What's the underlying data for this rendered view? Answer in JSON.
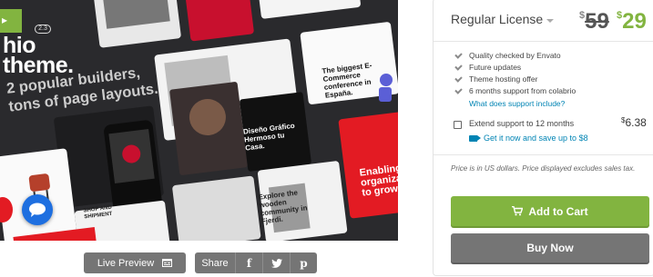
{
  "preview": {
    "hero_line1": "hio",
    "hero_line2": "theme.",
    "version_badge": "2.3",
    "subtitle_line1": "2 popular builders,",
    "subtitle_line2": "tons of page layouts.",
    "tile_texts": {
      "conference": "The biggest E-Commerce conference in España.",
      "diseno": "Diseño Gráfico Hermoso tu Casa.",
      "explore": "Explore the wooden community in Fjerdi.",
      "enabling": "Enabling organizations to grow",
      "shop": "SHOP AND SHIPMENT"
    }
  },
  "bottom_bar": {
    "live_preview_label": "Live Preview",
    "share_label": "Share",
    "share_icons": [
      "facebook-icon",
      "twitter-icon",
      "pinterest-icon"
    ],
    "facebook_glyph": "f",
    "pinterest_glyph": "p"
  },
  "purchase": {
    "license_label": "Regular License",
    "currency": "$",
    "old_price": "59",
    "new_price": "29",
    "features": [
      "Quality checked by Envato",
      "Future updates",
      "Theme hosting offer",
      "6 months support from colabrio"
    ],
    "support_link": "What does support include?",
    "extend_label": "Extend support to 12 months",
    "extend_price": "6.38",
    "extend_offer": "Get it now and save up to $8",
    "price_note": "Price is in US dollars. Price displayed excludes sales tax.",
    "add_to_cart": "Add to Cart",
    "buy_now": "Buy Now"
  },
  "colors": {
    "accent_green": "#82b440",
    "button_gray": "#757575",
    "link_blue": "#0084b4",
    "brand_red": "#e31b23"
  }
}
